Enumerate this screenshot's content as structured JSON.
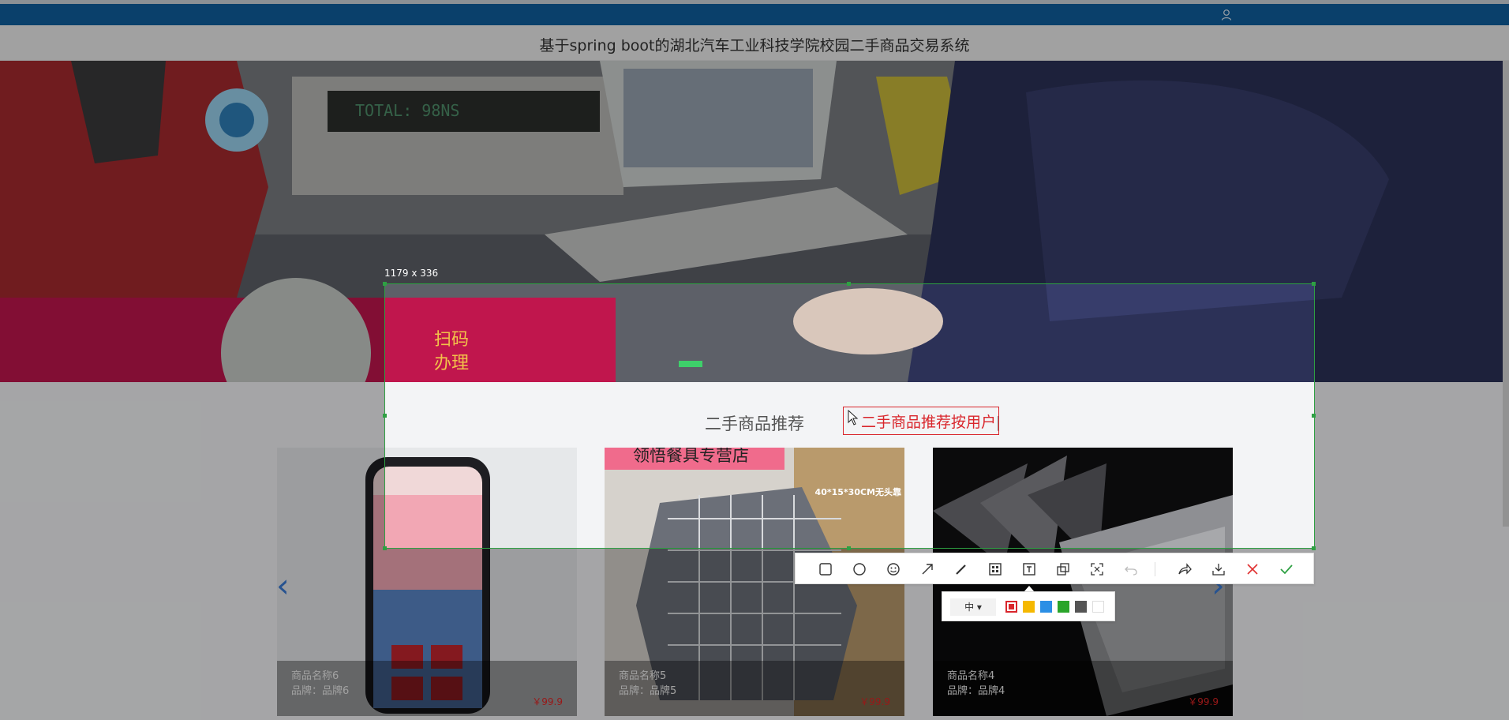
{
  "header": {
    "site_title": "基于spring boot的湖北汽车工业科技学院校园二手商品交易系统",
    "user_icon": "user-icon"
  },
  "banner": {
    "register_display": "TOTAL: 98NS",
    "sign_text_1": "扫码",
    "sign_text_2": "办理"
  },
  "recommend": {
    "title": "二手商品推荐",
    "products": [
      {
        "name": "商品名称6",
        "brand": "品牌：品牌6",
        "price": "￥99.9"
      },
      {
        "name": "商品名称5",
        "brand": "品牌：品牌5",
        "price": "￥99.9",
        "shop_banner": "领悟餐具专营店",
        "size_tag": "40*15*30CM无头靠"
      },
      {
        "name": "商品名称4",
        "brand": "品牌：品牌4",
        "price": "￥99.9"
      }
    ],
    "prev_arrow": "‹",
    "next_arrow": "›"
  },
  "screenshot_tool": {
    "selection_size": "1179 x 336",
    "annotation_text": "二手商品推荐按用户",
    "toolbar_icons": [
      "rectangle-icon",
      "ellipse-icon",
      "emoji-icon",
      "arrow-icon",
      "pen-icon",
      "mosaic-icon",
      "text-icon",
      "pin-icon",
      "ocr-icon",
      "undo-icon",
      "share-icon",
      "download-icon",
      "cancel-icon",
      "confirm-icon"
    ],
    "size_option": "中",
    "colors": [
      "#d9262c",
      "#f5b800",
      "#2b8fe5",
      "#2aa52a",
      "#555555",
      "#ffffff"
    ]
  }
}
